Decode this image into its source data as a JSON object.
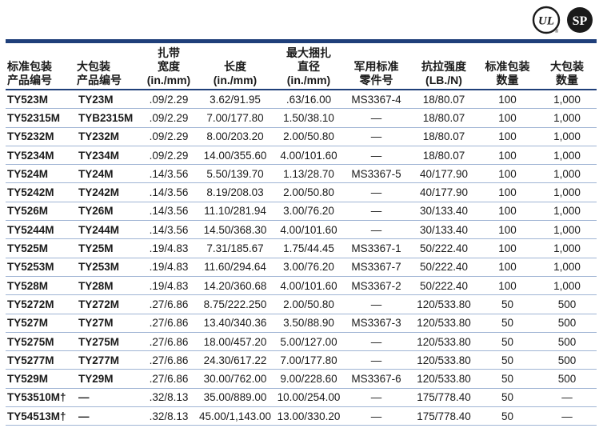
{
  "headers": [
    [
      "标准包装",
      "产品编号"
    ],
    [
      "大包装",
      "产品编号"
    ],
    [
      "扎带",
      "宽度",
      "(in./mm)"
    ],
    [
      "长度",
      "(in./mm)"
    ],
    [
      "最大捆扎",
      "直径",
      "(in./mm)"
    ],
    [
      "军用标准",
      "零件号"
    ],
    [
      "抗拉强度",
      "(LB./N)"
    ],
    [
      "标准包装",
      "数量"
    ],
    [
      "大包装",
      "数量"
    ]
  ],
  "rows": [
    [
      "TY523M",
      "TY23M",
      ".09/2.29",
      "3.62/91.95",
      ".63/16.00",
      "MS3367-4",
      "18/80.07",
      "100",
      "1,000"
    ],
    [
      "TY52315M",
      "TYB2315M",
      ".09/2.29",
      "7.00/177.80",
      "1.50/38.10",
      "—",
      "18/80.07",
      "100",
      "1,000"
    ],
    [
      "TY5232M",
      "TY232M",
      ".09/2.29",
      "8.00/203.20",
      "2.00/50.80",
      "—",
      "18/80.07",
      "100",
      "1,000"
    ],
    [
      "TY5234M",
      "TY234M",
      ".09/2.29",
      "14.00/355.60",
      "4.00/101.60",
      "—",
      "18/80.07",
      "100",
      "1,000"
    ],
    [
      "TY524M",
      "TY24M",
      ".14/3.56",
      "5.50/139.70",
      "1.13/28.70",
      "MS3367-5",
      "40/177.90",
      "100",
      "1,000"
    ],
    [
      "TY5242M",
      "TY242M",
      ".14/3.56",
      "8.19/208.03",
      "2.00/50.80",
      "—",
      "40/177.90",
      "100",
      "1,000"
    ],
    [
      "TY526M",
      "TY26M",
      ".14/3.56",
      "11.10/281.94",
      "3.00/76.20",
      "—",
      "30/133.40",
      "100",
      "1,000"
    ],
    [
      "TY5244M",
      "TY244M",
      ".14/3.56",
      "14.50/368.30",
      "4.00/101.60",
      "—",
      "30/133.40",
      "100",
      "1,000"
    ],
    [
      "TY525M",
      "TY25M",
      ".19/4.83",
      "7.31/185.67",
      "1.75/44.45",
      "MS3367-1",
      "50/222.40",
      "100",
      "1,000"
    ],
    [
      "TY5253M",
      "TY253M",
      ".19/4.83",
      "11.60/294.64",
      "3.00/76.20",
      "MS3367-7",
      "50/222.40",
      "100",
      "1,000"
    ],
    [
      "TY528M",
      "TY28M",
      ".19/4.83",
      "14.20/360.68",
      "4.00/101.60",
      "MS3367-2",
      "50/222.40",
      "100",
      "1,000"
    ],
    [
      "TY5272M",
      "TY272M",
      ".27/6.86",
      "8.75/222.250",
      "2.00/50.80",
      "—",
      "120/533.80",
      "50",
      "500"
    ],
    [
      "TY527M",
      "TY27M",
      ".27/6.86",
      "13.40/340.36",
      "3.50/88.90",
      "MS3367-3",
      "120/533.80",
      "50",
      "500"
    ],
    [
      "TY5275M",
      "TY275M",
      ".27/6.86",
      "18.00/457.20",
      "5.00/127.00",
      "—",
      "120/533.80",
      "50",
      "500"
    ],
    [
      "TY5277M",
      "TY277M",
      ".27/6.86",
      "24.30/617.22",
      "7.00/177.80",
      "—",
      "120/533.80",
      "50",
      "500"
    ],
    [
      "TY529M",
      "TY29M",
      ".27/6.86",
      "30.00/762.00",
      "9.00/228.60",
      "MS3367-6",
      "120/533.80",
      "50",
      "500"
    ],
    [
      "TY53510M†",
      "—",
      ".32/8.13",
      "35.00/889.00",
      "10.00/254.00",
      "—",
      "175/778.40",
      "50",
      "—"
    ],
    [
      "TY54513M†",
      "—",
      ".32/8.13",
      "45.00/1,143.00",
      "13.00/330.20",
      "—",
      "175/778.40",
      "50",
      "—"
    ]
  ],
  "logos": {
    "ul": {
      "mark": "UL",
      "tm": "®"
    },
    "csa": {
      "mark": "SP"
    }
  },
  "colors": {
    "rule": "#1f3f7a",
    "row_line": "#9fb3d4",
    "logo": "#1a1a1a"
  }
}
